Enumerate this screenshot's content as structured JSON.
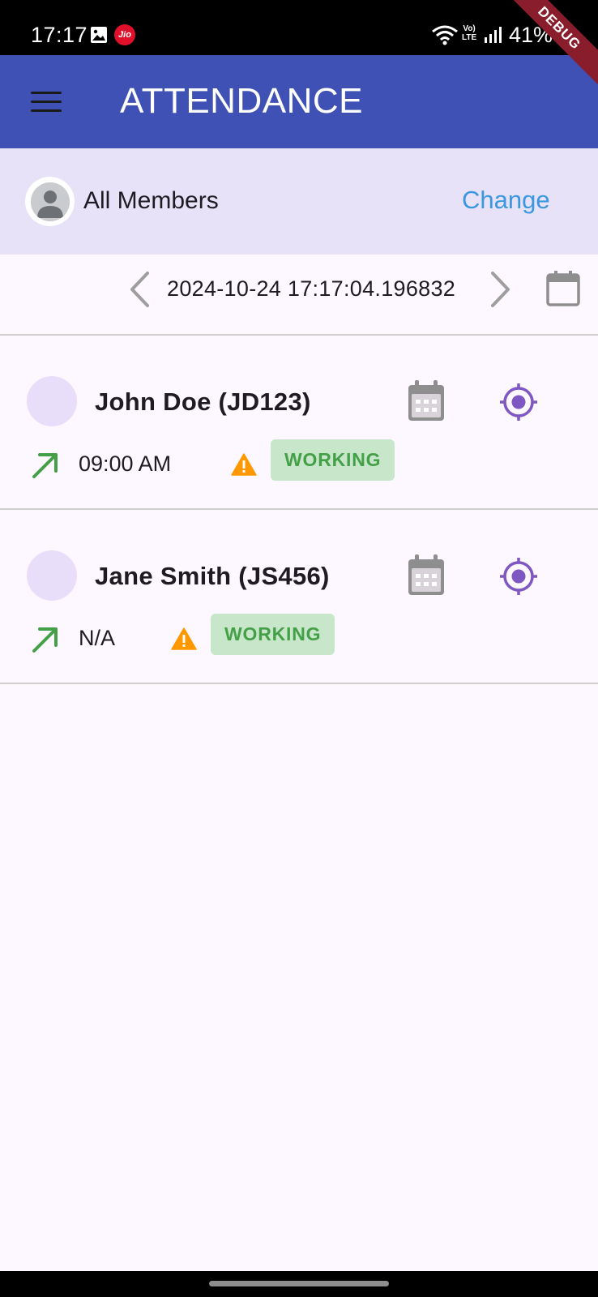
{
  "status_bar": {
    "time": "17:17",
    "carrier_badge": "Jio",
    "volte_top": "Vo)",
    "volte_bottom": "LTE",
    "battery": "41%"
  },
  "debug_banner": "DEBUG",
  "app_bar": {
    "title": "ATTENDANCE"
  },
  "member_selector": {
    "label": "All Members",
    "change_label": "Change"
  },
  "date_nav": {
    "date": "2024-10-24 17:17:04.196832"
  },
  "members": [
    {
      "name": "John Doe (JD123)",
      "check_in": "09:00 AM",
      "status": "WORKING"
    },
    {
      "name": "Jane Smith (JS456)",
      "check_in": "N/A",
      "status": "WORKING"
    }
  ],
  "colors": {
    "app_bar": "#3f51b5",
    "member_bar": "#e7e2f8",
    "background": "#fdf7ff",
    "accent_blue": "#3a97e0",
    "status_green": "#43a047",
    "status_green_bg": "#c8e6c9",
    "warning": "#ff9800",
    "location_purple": "#7e57c2"
  },
  "icons": {
    "menu": "menu-icon",
    "avatar": "person-icon",
    "prev": "chevron-left-icon",
    "next": "chevron-right-icon",
    "calendar": "calendar-icon",
    "location": "gps-target-icon",
    "check_in": "arrow-up-right-icon",
    "warning": "warning-icon"
  }
}
